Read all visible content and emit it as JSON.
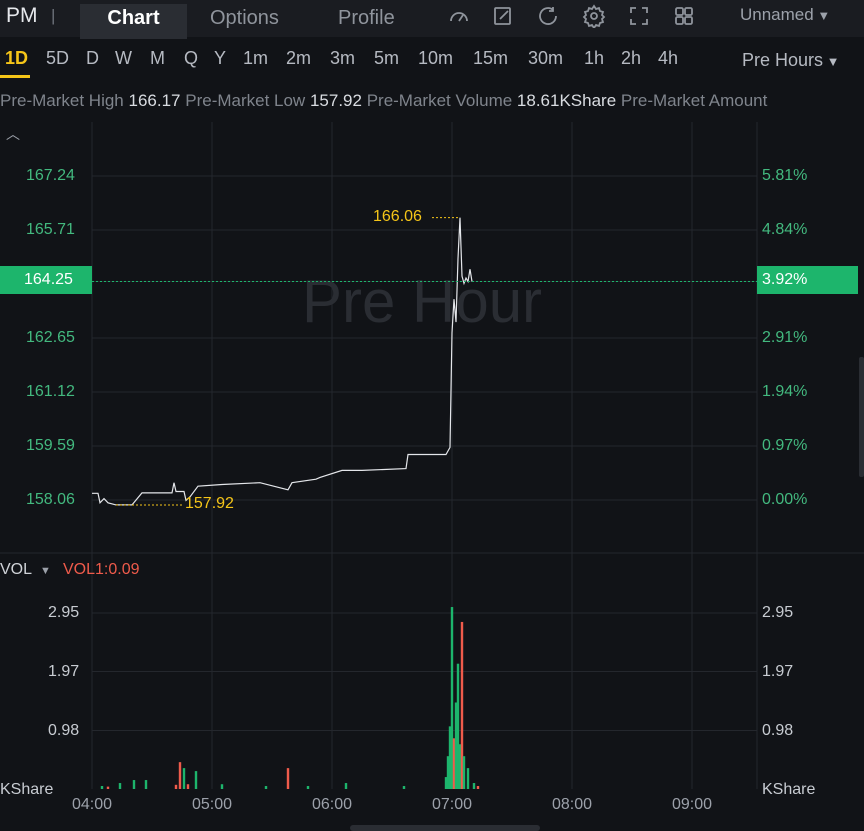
{
  "header": {
    "symbol": "PM",
    "separator": "|",
    "tabs": [
      "Chart",
      "Options",
      "Profile"
    ],
    "layout_name": "Unnamed"
  },
  "intervals": [
    "1D",
    "5D",
    "D",
    "W",
    "M",
    "Q",
    "Y",
    "1m",
    "2m",
    "3m",
    "5m",
    "10m",
    "15m",
    "30m",
    "1h",
    "2h",
    "4h"
  ],
  "session_selector": "Pre Hours",
  "stats": {
    "high_label": "Pre-Market High",
    "high": "166.17",
    "low_label": "Pre-Market Low",
    "low": "157.92",
    "volume_label": "Pre-Market Volume",
    "volume": "18.61KShare",
    "amount_label": "Pre-Market Amount"
  },
  "watermark": "Pre Hour",
  "price_axis": [
    "167.24",
    "165.71",
    "164.25",
    "162.65",
    "161.12",
    "159.59",
    "158.06"
  ],
  "pct_axis": [
    "5.81%",
    "4.84%",
    "3.92%",
    "2.91%",
    "1.94%",
    "0.97%",
    "0.00%"
  ],
  "current_price": "164.25",
  "current_pct": "3.92%",
  "high_marker": "166.06",
  "low_marker": "157.92",
  "volume_panel": {
    "title": "VOL",
    "indicator": "VOL1:0.09",
    "ticks": [
      "2.95",
      "1.97",
      "0.98"
    ],
    "unit": "KShare"
  },
  "time_axis": [
    "04:00",
    "05:00",
    "06:00",
    "07:00",
    "08:00",
    "09:00"
  ],
  "colors": {
    "accent": "#f5c518",
    "up": "#1db56c",
    "down": "#ef5b4b"
  },
  "chart_data": {
    "type": "line",
    "x_unit": "time",
    "ylim": [
      157.5,
      167.6
    ],
    "price": [
      [
        "04:00",
        158.25
      ],
      [
        "04:03",
        158.25
      ],
      [
        "04:04",
        157.98
      ],
      [
        "04:06",
        158.1
      ],
      [
        "04:08",
        157.98
      ],
      [
        "04:12",
        157.92
      ],
      [
        "04:20",
        157.92
      ],
      [
        "04:25",
        158.26
      ],
      [
        "04:40",
        158.26
      ],
      [
        "04:41",
        158.55
      ],
      [
        "04:42",
        158.3
      ],
      [
        "04:46",
        158.3
      ],
      [
        "04:47",
        158.05
      ],
      [
        "04:49",
        158.15
      ],
      [
        "04:53",
        158.45
      ],
      [
        "05:05",
        158.5
      ],
      [
        "05:24",
        158.55
      ],
      [
        "05:38",
        158.35
      ],
      [
        "05:40",
        158.55
      ],
      [
        "05:52",
        158.65
      ],
      [
        "05:54",
        158.7
      ],
      [
        "06:05",
        158.9
      ],
      [
        "06:15",
        158.9
      ],
      [
        "06:37",
        158.95
      ],
      [
        "06:38",
        159.35
      ],
      [
        "06:57",
        159.35
      ],
      [
        "06:59",
        159.55
      ],
      [
        "07:00",
        162.8
      ],
      [
        "07:01",
        163.75
      ],
      [
        "07:02",
        163.1
      ],
      [
        "07:03",
        164.9
      ],
      [
        "07:04",
        166.06
      ],
      [
        "07:05",
        164.4
      ],
      [
        "07:06",
        164.2
      ],
      [
        "07:07",
        164.35
      ],
      [
        "07:08",
        164.25
      ],
      [
        "07:09",
        164.6
      ],
      [
        "07:10",
        164.25
      ]
    ],
    "volume_kshare": [
      [
        "04:05",
        0.05
      ],
      [
        "04:08",
        0.04
      ],
      [
        "04:14",
        0.1
      ],
      [
        "04:21",
        0.15
      ],
      [
        "04:27",
        0.15
      ],
      [
        "04:42",
        0.07
      ],
      [
        "04:44",
        0.45
      ],
      [
        "04:46",
        0.35
      ],
      [
        "04:48",
        0.08
      ],
      [
        "04:52",
        0.3
      ],
      [
        "05:05",
        0.08
      ],
      [
        "05:27",
        0.05
      ],
      [
        "05:38",
        0.35
      ],
      [
        "05:48",
        0.05
      ],
      [
        "06:07",
        0.1
      ],
      [
        "06:36",
        0.05
      ],
      [
        "06:57",
        0.2
      ],
      [
        "06:58",
        0.55
      ],
      [
        "06:59",
        1.05
      ],
      [
        "07:00",
        3.05
      ],
      [
        "07:01",
        0.85
      ],
      [
        "07:02",
        1.45
      ],
      [
        "07:03",
        2.1
      ],
      [
        "07:04",
        0.75
      ],
      [
        "07:05",
        2.8
      ],
      [
        "07:06",
        0.55
      ],
      [
        "07:08",
        0.35
      ],
      [
        "07:11",
        0.1
      ],
      [
        "07:13",
        0.05
      ]
    ],
    "volume_colors": [
      "up",
      "down",
      "up",
      "up",
      "up",
      "down",
      "down",
      "up",
      "down",
      "up",
      "up",
      "up",
      "down",
      "up",
      "up",
      "up",
      "up",
      "up",
      "up",
      "up",
      "down",
      "up",
      "up",
      "up",
      "down",
      "up",
      "up",
      "up",
      "down"
    ],
    "xlim": [
      "04:00",
      "09:30"
    ]
  }
}
